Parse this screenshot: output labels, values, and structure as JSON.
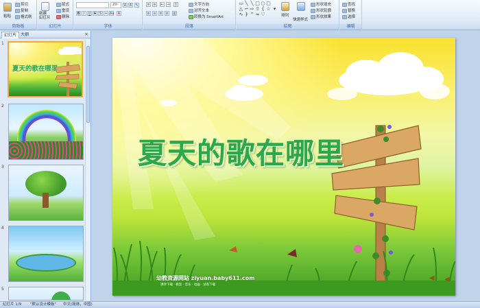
{
  "ribbon": {
    "clipboard": {
      "paste": "粘贴",
      "cut": "剪切",
      "copy": "复制",
      "format_painter": "格式刷",
      "label": "剪贴板"
    },
    "slides": {
      "new_slide": "新建\n幻灯片",
      "layout": "版式",
      "reset": "重设",
      "delete": "删除",
      "label": "幻灯片"
    },
    "font": {
      "font_name": "",
      "font_size": "20",
      "label": "字体"
    },
    "paragraph": {
      "text_direction": "文字方向",
      "align_text": "对齐文本",
      "convert_smartart": "转换为 SmartArt",
      "label": "段落"
    },
    "drawing": {
      "arrange": "排列",
      "quick_styles": "快速样式",
      "shape_fill": "形状填充",
      "shape_outline": "形状轮廓",
      "shape_effects": "形状效果",
      "label": "绘图"
    },
    "editing": {
      "find": "查找",
      "replace": "替换",
      "select": "选择",
      "label": "编辑"
    }
  },
  "panel": {
    "tab_slides": "幻灯片",
    "tab_outline": "大纲",
    "close": "×"
  },
  "thumbnails": [
    {
      "num": "1",
      "title": "夏天的歌在哪里"
    },
    {
      "num": "2"
    },
    {
      "num": "3"
    },
    {
      "num": "4"
    },
    {
      "num": "5"
    }
  ],
  "slide": {
    "title": "夏天的歌在哪里",
    "footer": "幼教资源网站 ziyuan.baby611.com",
    "footer_sub": "课件下载 · 教案 · 音乐 · 动画 · 试卷下载"
  },
  "status": {
    "slide_info": "幻灯片 1/9",
    "theme": "\"默认设计模板\"",
    "language": "中文(简体，中国)"
  },
  "colors": {
    "accent": "#2aa84a",
    "ribbon_border": "#8db2e3",
    "selection": "#f2a93b"
  }
}
